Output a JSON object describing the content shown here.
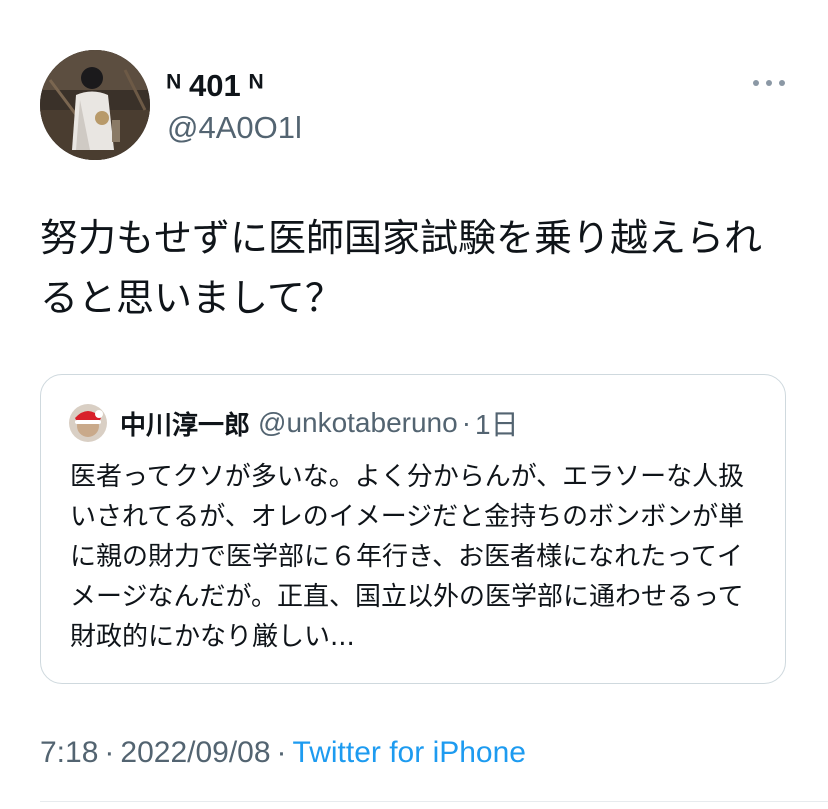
{
  "author": {
    "display_name": "ꟷ 401 ꟷ",
    "display_name_text": "ᴺ 401 ᴺ",
    "handle": "@4A0O1l"
  },
  "tweet": {
    "text": "努力もせずに医師国家試験を乗り越えられると思いまして？"
  },
  "quote": {
    "name": "中川淳一郎",
    "handle": "@unkotaberuno",
    "separator": "·",
    "time": "1日",
    "text": "医者ってクソが多いな。よく分からんが、エラソーな人扱いされてるが、オレのイメージだと金持ちのボンボンが単に親の財力で医学部に６年行き、お医者様になれたってイメージなんだが。正直、国立以外の医学部に通わせるって財政的にかなり厳しい..."
  },
  "meta": {
    "time": "7:18",
    "separator": "·",
    "date": "2022/09/08",
    "source": "Twitter for iPhone"
  },
  "icons": {
    "more": "more-horizontal-icon",
    "avatar": "avatar-photo",
    "quote_avatar": "avatar-photo"
  },
  "colors": {
    "text": "#0f1419",
    "secondary": "#536471",
    "link": "#1d9bf0",
    "border": "#cfd9de"
  }
}
